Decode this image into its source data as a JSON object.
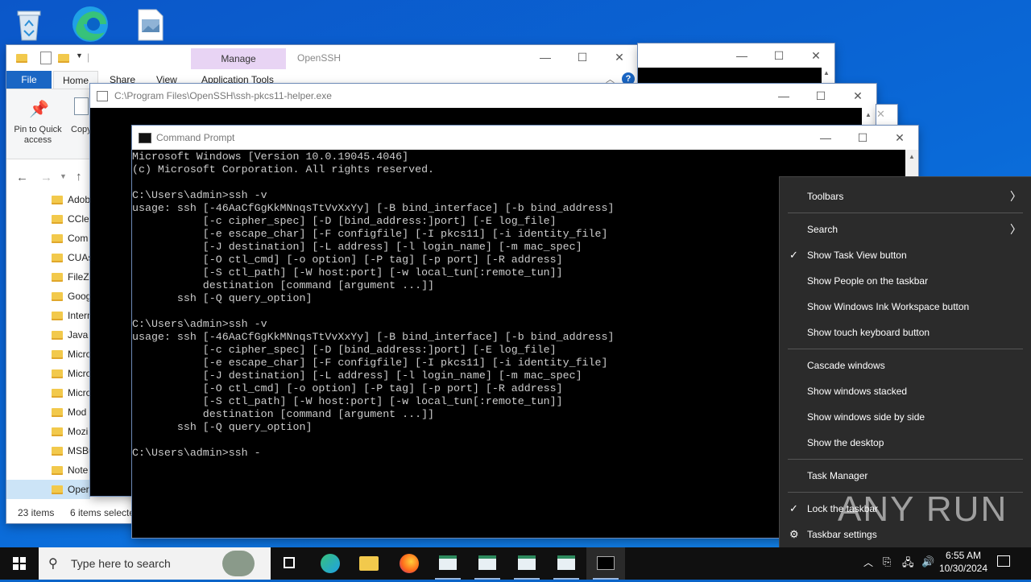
{
  "explorer": {
    "manage_label": "Manage",
    "title": "OpenSSH",
    "tabs": [
      "File",
      "Home",
      "Share",
      "View",
      "Application Tools"
    ],
    "ribbon": {
      "pin_label": "Pin to Quick access",
      "copy_label": "Copy"
    },
    "nav_items": [
      "Adob",
      "CClea",
      "Com",
      "CUAs",
      "FileZ",
      "Goog",
      "Intern",
      "Java",
      "Micro",
      "Micro",
      "Micro",
      "Mod",
      "Mozi",
      "MSBu",
      "Note",
      "Oper"
    ],
    "status_items": "23 items",
    "status_selected": "6 items selecte"
  },
  "helper_window": {
    "title": "C:\\Program Files\\OpenSSH\\ssh-pkcs11-helper.exe"
  },
  "cmd": {
    "title": "Command Prompt",
    "lines": [
      "Microsoft Windows [Version 10.0.19045.4046]",
      "(c) Microsoft Corporation. All rights reserved.",
      "",
      "C:\\Users\\admin>ssh -v",
      "usage: ssh [-46AaCfGgKkMNnqsTtVvXxYy] [-B bind_interface] [-b bind_address]",
      "           [-c cipher_spec] [-D [bind_address:]port] [-E log_file]",
      "           [-e escape_char] [-F configfile] [-I pkcs11] [-i identity_file]",
      "           [-J destination] [-L address] [-l login_name] [-m mac_spec]",
      "           [-O ctl_cmd] [-o option] [-P tag] [-p port] [-R address]",
      "           [-S ctl_path] [-W host:port] [-w local_tun[:remote_tun]]",
      "           destination [command [argument ...]]",
      "       ssh [-Q query_option]",
      "",
      "C:\\Users\\admin>ssh -v",
      "usage: ssh [-46AaCfGgKkMNnqsTtVvXxYy] [-B bind_interface] [-b bind_address]",
      "           [-c cipher_spec] [-D [bind_address:]port] [-E log_file]",
      "           [-e escape_char] [-F configfile] [-I pkcs11] [-i identity_file]",
      "           [-J destination] [-L address] [-l login_name] [-m mac_spec]",
      "           [-O ctl_cmd] [-o option] [-P tag] [-p port] [-R address]",
      "           [-S ctl_path] [-W host:port] [-w local_tun[:remote_tun]]",
      "           destination [command [argument ...]]",
      "       ssh [-Q query_option]",
      "",
      "C:\\Users\\admin>ssh -"
    ]
  },
  "context_menu": {
    "items": [
      {
        "label": "Toolbars",
        "checked": false,
        "submenu": true
      },
      {
        "label": "Search",
        "checked": false,
        "submenu": true
      },
      {
        "label": "Show Task View button",
        "checked": true,
        "submenu": false
      },
      {
        "label": "Show People on the taskbar",
        "checked": false,
        "submenu": false
      },
      {
        "label": "Show Windows Ink Workspace button",
        "checked": false,
        "submenu": false
      },
      {
        "label": "Show touch keyboard button",
        "checked": false,
        "submenu": false
      },
      {
        "label": "Cascade windows",
        "checked": false,
        "submenu": false
      },
      {
        "label": "Show windows stacked",
        "checked": false,
        "submenu": false
      },
      {
        "label": "Show windows side by side",
        "checked": false,
        "submenu": false
      },
      {
        "label": "Show the desktop",
        "checked": false,
        "submenu": false
      },
      {
        "label": "Task Manager",
        "checked": false,
        "submenu": false
      },
      {
        "label": "Lock the taskbar",
        "checked": true,
        "submenu": false
      },
      {
        "label": "Taskbar settings",
        "checked": false,
        "submenu": false
      }
    ]
  },
  "taskbar": {
    "search_placeholder": "Type here to search",
    "time": "6:55 AM",
    "date": "10/30/2024"
  },
  "watermark": "ANY RUN",
  "colors": {
    "desktop": "#0a64c8",
    "taskbar": "#101010",
    "menu_bg": "#2b2b2b",
    "manage_tab": "#e8d4f4",
    "console_text": "#cccccc"
  }
}
